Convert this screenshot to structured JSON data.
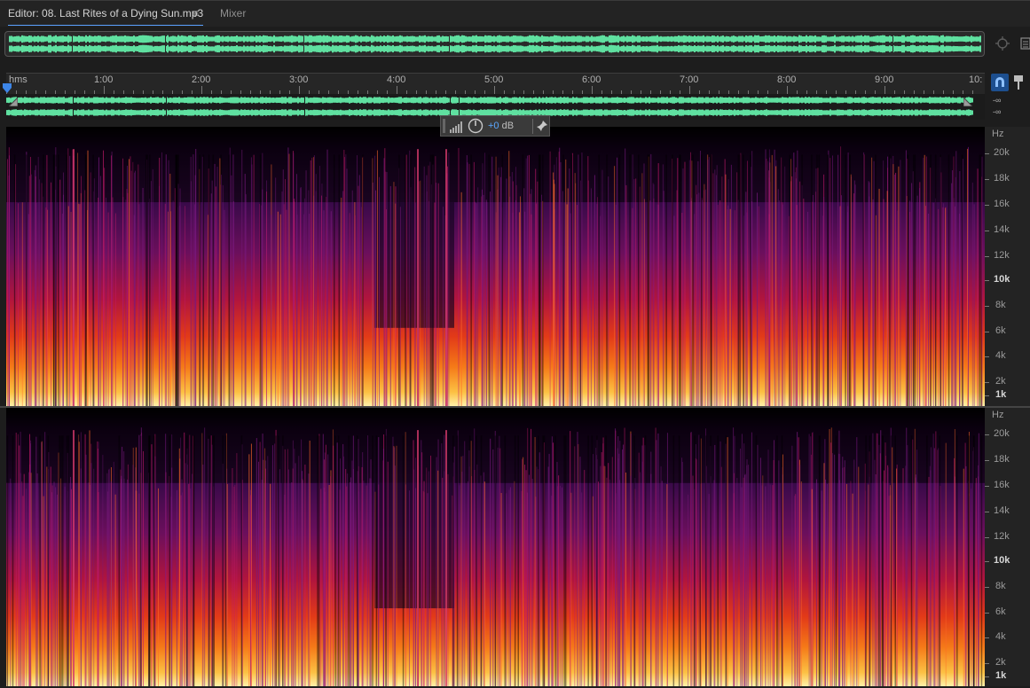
{
  "tabs": {
    "editor_label": "Editor: 08. Last Rites of a Dying Sun.mp3",
    "mixer_label": "Mixer",
    "menu_glyph": "≡"
  },
  "ruler": {
    "unit_label": "hms",
    "ticks": [
      "1:00",
      "2:00",
      "3:00",
      "4:00",
      "5:00",
      "6:00",
      "7:00",
      "8:00",
      "9:00",
      "10:"
    ]
  },
  "meters": {
    "top_channel": "-∞",
    "bottom_channel": "-∞"
  },
  "hud": {
    "gain_value": "+0",
    "gain_unit": "dB"
  },
  "freq_axis": {
    "unit": "Hz",
    "labels": [
      {
        "text": "20k",
        "bold": false
      },
      {
        "text": "18k",
        "bold": false
      },
      {
        "text": "16k",
        "bold": false
      },
      {
        "text": "14k",
        "bold": false
      },
      {
        "text": "12k",
        "bold": false
      },
      {
        "text": "10k",
        "bold": true
      },
      {
        "text": "8k",
        "bold": false
      },
      {
        "text": "6k",
        "bold": false
      },
      {
        "text": "4k",
        "bold": false
      },
      {
        "text": "2k",
        "bold": false
      },
      {
        "text": "1k",
        "bold": true
      }
    ]
  },
  "icons": {
    "zoom": "crosshair-zoom-icon",
    "list": "list-icon",
    "snap": "snap-magnet-icon",
    "marker": "marker-pin-icon",
    "pin": "pin-icon",
    "knob": "gain-knob-icon"
  },
  "colors": {
    "waveform": "#5fe0a0",
    "accent_blue": "#5aa7ff",
    "snap_button": "#1d4f8f"
  }
}
